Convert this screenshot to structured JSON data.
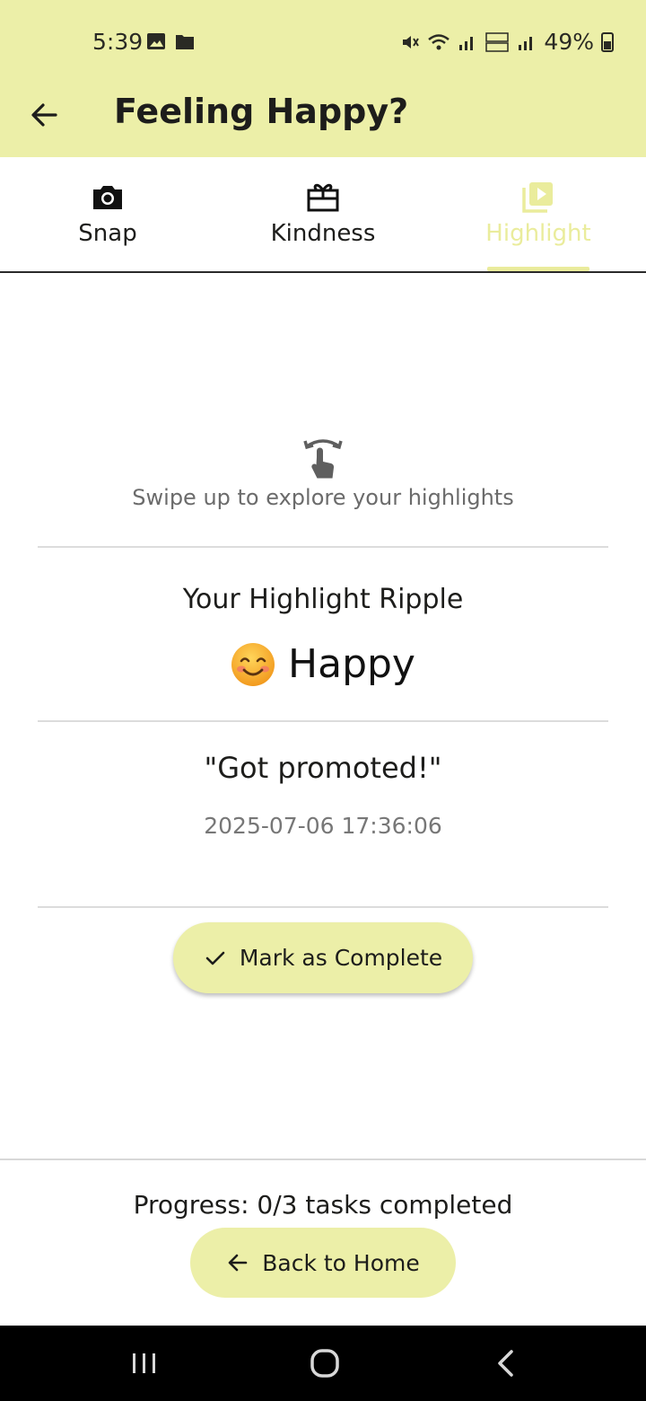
{
  "status_bar": {
    "time": "5:39",
    "battery": "49%"
  },
  "app_bar": {
    "title": "Feeling Happy?"
  },
  "tabs": [
    {
      "label": "Snap",
      "icon": "camera-icon",
      "active": false
    },
    {
      "label": "Kindness",
      "icon": "gift-icon",
      "active": false
    },
    {
      "label": "Highlight",
      "icon": "video-library-icon",
      "active": true
    }
  ],
  "content": {
    "swipe_hint": "Swipe up to explore your highlights",
    "ripple_title": "Your Highlight Ripple",
    "emotion_emoji": "smiling-face-emoji",
    "emotion_label": "Happy",
    "quote": "\"Got promoted!\"",
    "timestamp": "2025-07-06 17:36:06",
    "complete_button": "Mark as Complete"
  },
  "footer": {
    "progress": "Progress: 0/3 tasks completed",
    "home_button": "Back to Home"
  },
  "colors": {
    "accent": "#ecefa8",
    "active_tab": "#eaec9c"
  }
}
